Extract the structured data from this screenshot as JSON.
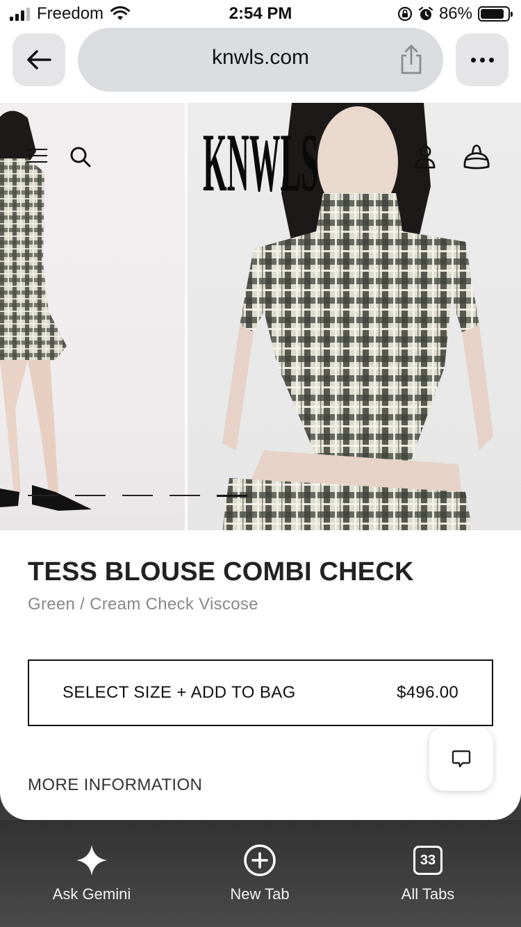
{
  "status_bar": {
    "carrier": "Freedom",
    "time": "2:54 PM",
    "battery_percent": "86%",
    "battery_level": 0.86
  },
  "browser": {
    "url": "knwls.com",
    "icons": [
      "back-arrow-icon",
      "share-icon",
      "more-icon"
    ]
  },
  "site_header": {
    "logo_text": "KNWLS",
    "icons": [
      "menu-icon",
      "search-icon",
      "account-icon",
      "bag-icon"
    ]
  },
  "carousel": {
    "slide_count": 5,
    "active_index": 4
  },
  "product": {
    "title": "TESS BLOUSE COMBI CHECK",
    "subtitle": "Green / Cream Check Viscose",
    "add_to_bag_label": "SELECT SIZE + ADD TO BAG",
    "price": "$496.00",
    "more_information_label": "MORE INFORMATION"
  },
  "bottom_bar": {
    "items": [
      {
        "label": "Ask Gemini",
        "icon": "gemini-sparkle-icon"
      },
      {
        "label": "New Tab",
        "icon": "plus-circle-icon"
      },
      {
        "label": "All Tabs",
        "icon": "tabs-count-icon",
        "count": "33"
      }
    ]
  }
}
